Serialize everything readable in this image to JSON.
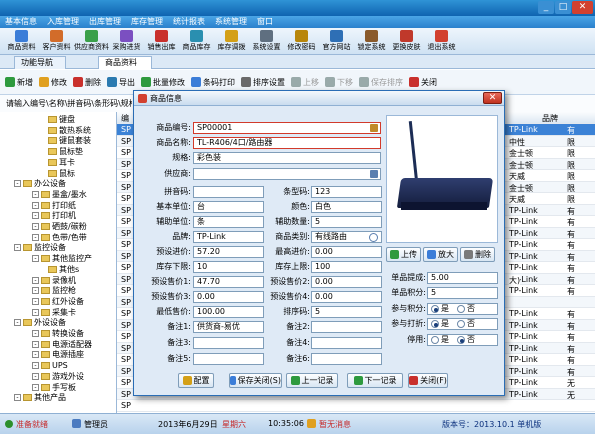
{
  "menubar": [
    "基本信息",
    "入库管理",
    "出库管理",
    "库存管理",
    "统计报表",
    "系统管理",
    "窗口"
  ],
  "toolbar": [
    "商品资料",
    "客户资料",
    "供应商资料",
    "采购进货",
    "销售出库",
    "商品库存",
    "库存调拨",
    "系统设置",
    "修改密码",
    "官方网站",
    "锁定系统",
    "更换皮肤",
    "退出系统"
  ],
  "tabs": {
    "nav": "功能导航",
    "product": "商品资料"
  },
  "subtool": [
    "新增",
    "修改",
    "删除",
    "导出",
    "批量修改",
    "条码打印",
    "排序设置",
    "上移",
    "下移",
    "保存排序",
    "关闭"
  ],
  "search": {
    "label": "请输入编号\\名称\\拼音码\\条形码\\规格型号"
  },
  "tree": [
    {
      "label": "键盘",
      "level": 3
    },
    {
      "label": "散热系统",
      "level": 3
    },
    {
      "label": "键鼠套装",
      "level": 3
    },
    {
      "label": "鼠标垫",
      "level": 3
    },
    {
      "label": "耳卡",
      "level": 3
    },
    {
      "label": "鼠标",
      "level": 3
    },
    {
      "label": "办公设备",
      "level": 1
    },
    {
      "label": "墨盒/墨水",
      "level": 2
    },
    {
      "label": "打印纸",
      "level": 2
    },
    {
      "label": "打印机",
      "level": 2
    },
    {
      "label": "硒鼓/碳粉",
      "level": 2
    },
    {
      "label": "色带/色带",
      "level": 2
    },
    {
      "label": "监控设备",
      "level": 1
    },
    {
      "label": "其他监控产",
      "level": 2
    },
    {
      "label": "其他s",
      "level": 3
    },
    {
      "label": "录像机",
      "level": 2
    },
    {
      "label": "监控枪",
      "level": 2
    },
    {
      "label": "红外设备",
      "level": 2
    },
    {
      "label": "采集卡",
      "level": 2
    },
    {
      "label": "外设设备",
      "level": 1
    },
    {
      "label": "转换设备",
      "level": 2
    },
    {
      "label": "电源适配器",
      "level": 2
    },
    {
      "label": "电源插座",
      "level": 2
    },
    {
      "label": "UPS",
      "level": 2
    },
    {
      "label": "游戏外设",
      "level": 2
    },
    {
      "label": "手写板",
      "level": 2
    },
    {
      "label": "其他产品",
      "level": 1
    }
  ],
  "grid": {
    "header_first": "编",
    "header_brand": "品牌",
    "codes": [
      "SP",
      "SP",
      "SP",
      "SP",
      "SP",
      "SP",
      "SP",
      "SP",
      "SP",
      "SP",
      "SP",
      "SP",
      "SP",
      "SP",
      "SP",
      "SP",
      "SP",
      "SP",
      "SP",
      "SP",
      "SP",
      "SP",
      "SP",
      "SP",
      "SP"
    ],
    "brands": [
      "TP-Link",
      "中性",
      "金士顿",
      "金士顿",
      "天威",
      "金士顿",
      "天威",
      "TP-Link",
      "TP-Link",
      "TP-Link",
      "TP-Link",
      "TP-Link",
      "TP-Link",
      "TP-Link",
      "TP-Link",
      "",
      "TP-Link",
      "TP-Link",
      "TP-Link",
      "TP-Link",
      "TP-Link",
      "TP-Link",
      "TP-Link",
      "TP-Link"
    ],
    "tails": [
      "有",
      "限",
      "限",
      "限",
      "限",
      "限",
      "限",
      "有",
      "有",
      "有",
      "有",
      "有",
      "有",
      "有",
      "有",
      "",
      "有",
      "有",
      "有",
      "有",
      "有",
      "有",
      "无",
      "无"
    ],
    "max_label": "大)"
  },
  "dialog": {
    "title": "商品信息",
    "code_label": "商品编号:",
    "code": "SP00001",
    "name_label": "商品名称:",
    "name": "TL-R406/4口/路由器",
    "spec_label": "规格:",
    "spec": "彩色装",
    "supplier_label": "供应商:",
    "supplier": "",
    "pinyin_label": "拼音码:",
    "pinyin": "",
    "barcode_label": "条型码:",
    "barcode": "123",
    "unit_label": "基本单位:",
    "unit": "台",
    "color_label": "颜色:",
    "color": "白色",
    "aux_unit_label": "辅助单位:",
    "aux_unit": "条",
    "aux_qty_label": "辅助数量:",
    "aux_qty": "5",
    "brand_label": "品牌:",
    "brand": "TP-Link",
    "category_label": "商品类别:",
    "category": "有线路由",
    "purchase_label": "预设进价:",
    "purchase": "57.20",
    "max_purchase_label": "最高进价:",
    "max_purchase": "0.00",
    "stock_min_label": "库存下限:",
    "stock_min": "10",
    "stock_max_label": "库存上限:",
    "stock_max": "100",
    "sale1_label": "预设售价1:",
    "sale1": "47.70",
    "sale2_label": "预设售价2:",
    "sale2": "0.00",
    "sale3_label": "预设售价3:",
    "sale3": "0.00",
    "sale4_label": "预设售价4:",
    "sale4": "0.00",
    "min_price_label": "最低售价:",
    "min_price": "100.00",
    "sort_label": "排序码:",
    "sort": "5",
    "note1_label": "备注1:",
    "note1": "供货商-易优",
    "note2_label": "备注2:",
    "note2": "",
    "note3_label": "备注3:",
    "note3": "",
    "note4_label": "备注4:",
    "note4": "",
    "note5_label": "备注5:",
    "note5": "",
    "note6_label": "备注6:",
    "note6": "",
    "upload": "上传",
    "zoom": "放大",
    "del": "删除",
    "remind_label": "单品提成:",
    "remind": "5.00",
    "points_label": "单品积分:",
    "points": "5",
    "join_points_label": "参与积分:",
    "join_discount_label": "参与打折:",
    "disable_label": "停用:",
    "yes": "是",
    "no": "否",
    "config": "配置",
    "save_close": "保存关闭(S)",
    "prev": "上一记录",
    "next": "下一记录",
    "close": "关闭(F)"
  },
  "status": {
    "state": "准备就绪",
    "user": "管理员",
    "date": "2013年6月29日",
    "weekday": "星期六",
    "time": "10:35:06",
    "msg": "暂无消息",
    "version": "版本号：2013.10.1 单机版"
  }
}
